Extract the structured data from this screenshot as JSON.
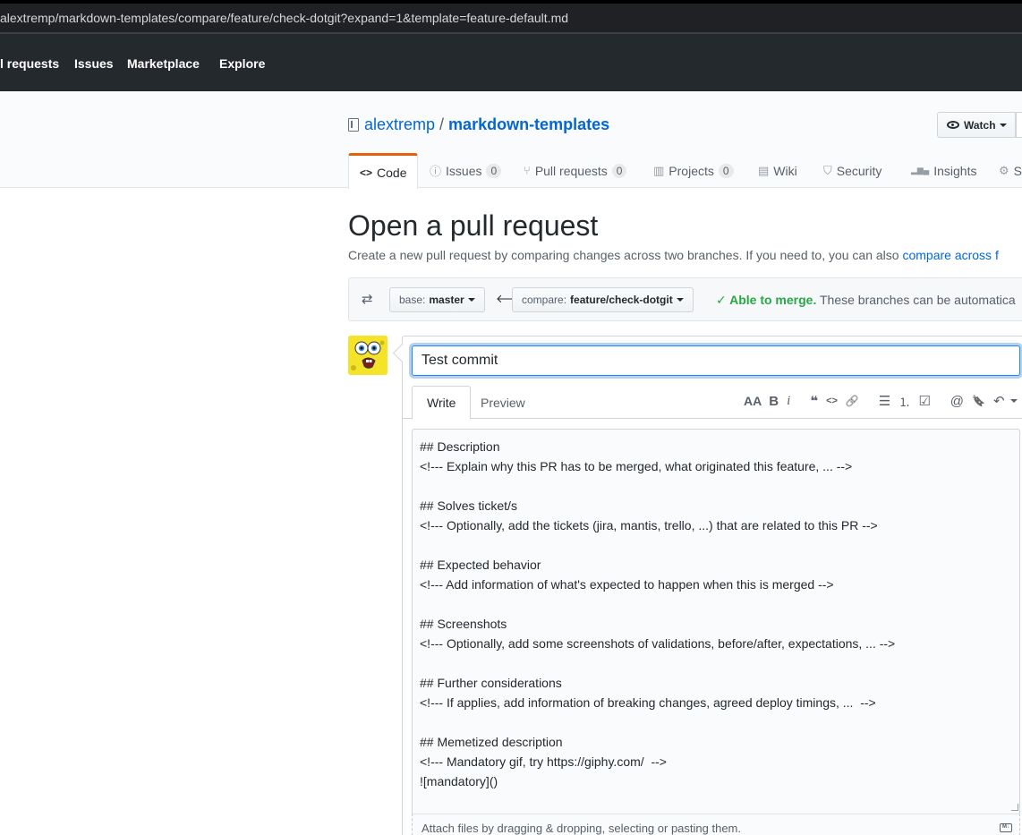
{
  "browser": {
    "url": "alextremp/markdown-templates/compare/feature/check-dotgit?expand=1&template=feature-default.md"
  },
  "topnav": {
    "items": [
      "l requests",
      "Issues",
      "Marketplace",
      "Explore"
    ]
  },
  "repo": {
    "owner": "alextremp",
    "separator": "/",
    "name": "markdown-templates",
    "watch_label": "Watch"
  },
  "tabs": [
    {
      "label": "Code",
      "icon": "code-icon",
      "glyph": "<>"
    },
    {
      "label": "Issues",
      "icon": "issue-icon",
      "glyph": "ⓘ",
      "count": "0"
    },
    {
      "label": "Pull requests",
      "icon": "pull-request-icon",
      "glyph": "⑂",
      "count": "0"
    },
    {
      "label": "Projects",
      "icon": "project-icon",
      "glyph": "▥",
      "count": "0"
    },
    {
      "label": "Wiki",
      "icon": "book-icon",
      "glyph": "▤"
    },
    {
      "label": "Security",
      "icon": "shield-icon",
      "glyph": "⛉"
    },
    {
      "label": "Insights",
      "icon": "graph-icon",
      "glyph": "▂▆▄"
    },
    {
      "label": "S",
      "icon": "gear-icon",
      "glyph": "⚙"
    }
  ],
  "main": {
    "title": "Open a pull request",
    "subtitle": "Create a new pull request by comparing changes across two branches. If you need to, you can also ",
    "subtitle_link": "compare across f"
  },
  "compare": {
    "base_prefix": "base:",
    "base_branch": "master",
    "compare_prefix": "compare:",
    "compare_branch": "feature/check-dotgit",
    "merge_ok": "✓ Able to merge.",
    "merge_text": " These branches can be automatica"
  },
  "form": {
    "title_value": "Test commit",
    "write_tab": "Write",
    "preview_tab": "Preview",
    "toolbar": [
      "AA",
      "B",
      "i",
      "❝",
      "<>",
      "🔗",
      "☰",
      "⒈",
      "☑",
      "@",
      "🔖",
      "↶"
    ],
    "body": "## Description\n<!--- Explain why this PR has to be merged, what originated this feature, ... -->\n\n## Solves ticket/s\n<!--- Optionally, add the tickets (jira, mantis, trello, ...) that are related to this PR -->\n\n## Expected behavior\n<!--- Add information of what's expected to happen when this is merged -->\n\n## Screenshots\n<!--- Optionally, add some screenshots of validations, before/after, expectations, ... -->\n\n## Further considerations\n<!--- If applies, add information of breaking changes, agreed deploy timings, ...  -->\n\n## Memetized description\n<!--- Mandatory gif, try https://giphy.com/  -->\n![mandatory]()",
    "attach_text": "Attach files by dragging & dropping, selecting or pasting them.",
    "markdown_badge": "M↓"
  }
}
